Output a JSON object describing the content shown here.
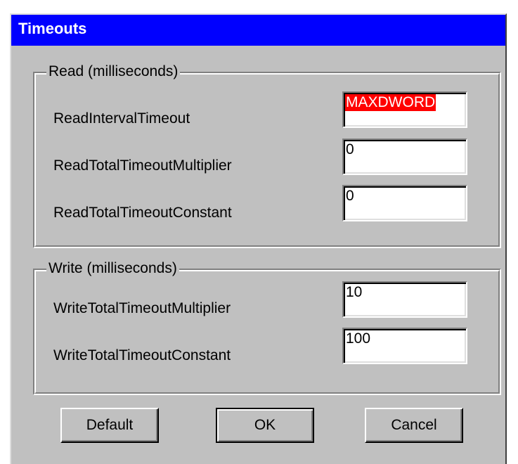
{
  "window": {
    "title": "Timeouts"
  },
  "read_group": {
    "legend": "Read  (milliseconds)",
    "fields": [
      {
        "label": "ReadIntervalTimeout",
        "value": "MAXDWORD"
      },
      {
        "label": "ReadTotalTimeoutMultiplier",
        "value": "0"
      },
      {
        "label": "ReadTotalTimeoutConstant",
        "value": "0"
      }
    ]
  },
  "write_group": {
    "legend": "Write  (milliseconds)",
    "fields": [
      {
        "label": "WriteTotalTimeoutMultiplier",
        "value": "10"
      },
      {
        "label": "WriteTotalTimeoutConstant",
        "value": "100"
      }
    ]
  },
  "buttons": {
    "default_label": "Default",
    "ok_label": "OK",
    "cancel_label": "Cancel"
  },
  "colors": {
    "titlebar": "#0000ff",
    "face": "#c0c0c0",
    "highlight_value": "#ff0000"
  }
}
